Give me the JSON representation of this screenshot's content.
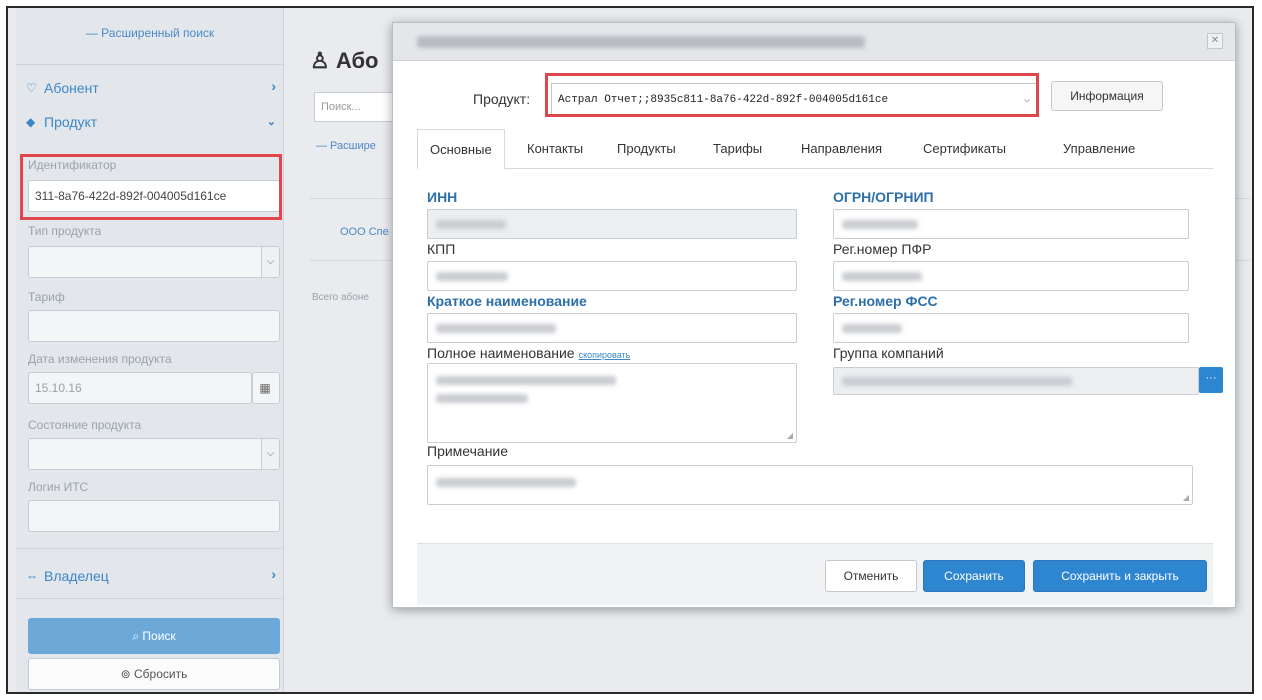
{
  "sidebar": {
    "advanced_search": "— Расширенный поиск",
    "subscriber_label": "Абонент",
    "product_label": "Продукт",
    "owner_label": "Владелец",
    "fields": {
      "identifier": {
        "label": "Идентификатор",
        "value": "311-8a76-422d-892f-004005d161ce"
      },
      "product_type": {
        "label": "Тип продукта",
        "value": ""
      },
      "tariff": {
        "label": "Тариф",
        "value": ""
      },
      "change_date": {
        "label": "Дата изменения продукта",
        "value": "15.10.16"
      },
      "product_state": {
        "label": "Состояние продукта",
        "value": ""
      },
      "its_login": {
        "label": "Логин ИТС",
        "value": ""
      }
    },
    "search_button": "Поиск",
    "reset_button": "Сбросить"
  },
  "background": {
    "title": "Або",
    "search_placeholder": "Поиск...",
    "advanced": "— Расшире",
    "company": "ООО Спе",
    "total": "Всего абоне"
  },
  "modal": {
    "product_label": "Продукт:",
    "product_value": "Астрал Отчет;;8935c811-8a76-422d-892f-004005d161ce",
    "info_button": "Информация",
    "tabs": [
      "Основные",
      "Контакты",
      "Продукты",
      "Тарифы",
      "Направления",
      "Сертификаты",
      "Управление"
    ],
    "active_tab": "Основные",
    "fields": {
      "inn": "ИНН",
      "ogrn": "ОГРН/ОГРНИП",
      "kpp": "КПП",
      "pfr": "Рег.номер ПФР",
      "short_name": "Краткое наименование",
      "fss": "Рег.номер ФСС",
      "full_name": "Полное наименование",
      "copy_link": "скопировать",
      "company_group": "Группа компаний",
      "note": "Примечание"
    },
    "buttons": {
      "cancel": "Отменить",
      "save": "Сохранить",
      "save_close": "Сохранить и закрыть"
    }
  },
  "colors": {
    "accent": "#2f86d0",
    "highlight": "#e0474c",
    "sidebar_bg": "#e3e7ec"
  }
}
